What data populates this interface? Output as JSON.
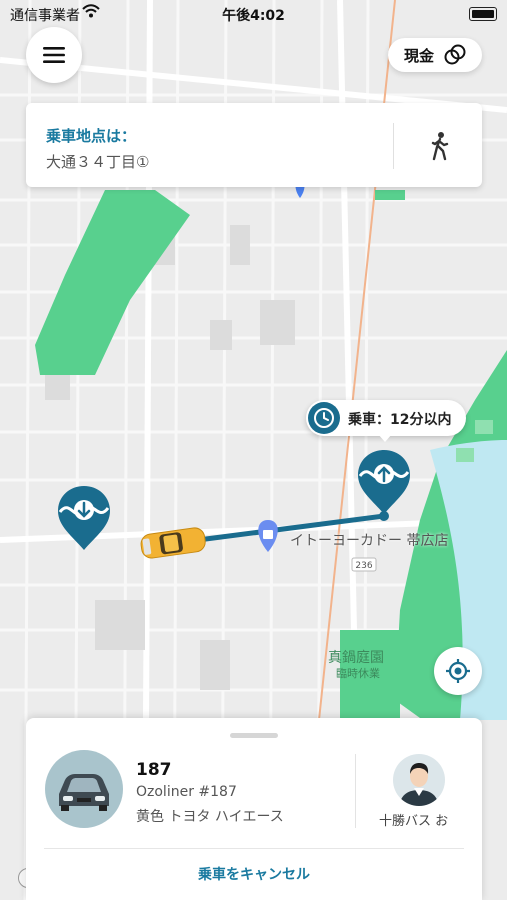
{
  "status_bar": {
    "carrier": "通信事業者",
    "time": "午後4:02"
  },
  "header": {
    "payment_label": "現金"
  },
  "pickup": {
    "title": "乗車地点は：",
    "address": "大通３４丁目①"
  },
  "eta": {
    "text": "乗車：12分以内"
  },
  "map": {
    "store_label": "イトーヨーカドー 帯広店",
    "garden_label": "真鍋庭園",
    "garden_sub": "臨時休業",
    "route_badge": "236"
  },
  "vehicle": {
    "number": "187",
    "name": "Ozoliner #187",
    "description": "黄色 トヨタ ハイエース",
    "company": "十勝バス お"
  },
  "actions": {
    "cancel": "乗車をキャンセル"
  },
  "colors": {
    "accent": "#1a7aa0",
    "marker": "#1a6c8e",
    "park": "#58d08e",
    "water": "#bfe8f2"
  },
  "icons": {
    "menu": "hamburger-icon",
    "payment": "coins-icon",
    "walk": "walking-person-icon",
    "clock": "clock-icon",
    "pickup_marker": "pickup-marker-icon",
    "dropoff_marker": "dropoff-marker-icon",
    "locate": "crosshair-icon"
  }
}
